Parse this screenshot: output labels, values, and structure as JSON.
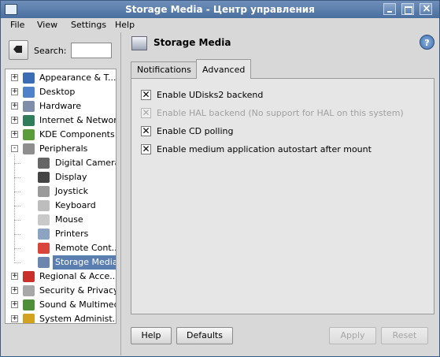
{
  "window": {
    "title": "Storage Media - Центр управления"
  },
  "menubar": {
    "items": [
      "File",
      "View",
      "Settings",
      "Help"
    ]
  },
  "sidebar": {
    "search_label": "Search:",
    "search_value": "",
    "tree": [
      {
        "label": "Appearance & T...",
        "icon": "appearance-icon",
        "expander": "+",
        "color": "#3b6db3"
      },
      {
        "label": "Desktop",
        "icon": "desktop-icon",
        "expander": "+",
        "color": "#4f82c6"
      },
      {
        "label": "Hardware",
        "icon": "hardware-icon",
        "expander": "+",
        "color": "#7f8ea8"
      },
      {
        "label": "Internet & Network",
        "icon": "globe-icon",
        "expander": "+",
        "color": "#2f7d5a"
      },
      {
        "label": "KDE Components",
        "icon": "components-icon",
        "expander": "+",
        "color": "#5c9d3b"
      },
      {
        "label": "Peripherals",
        "icon": "peripherals-icon",
        "expander": "-",
        "color": "#8e8e8e"
      },
      {
        "label": "Digital Camera",
        "icon": "camera-icon",
        "color": "#666666"
      },
      {
        "label": "Display",
        "icon": "display-icon",
        "color": "#444444"
      },
      {
        "label": "Joystick",
        "icon": "joystick-icon",
        "color": "#9a9a9a"
      },
      {
        "label": "Keyboard",
        "icon": "keyboard-icon",
        "color": "#bdbdbd"
      },
      {
        "label": "Mouse",
        "icon": "mouse-icon",
        "color": "#c9c9c9"
      },
      {
        "label": "Printers",
        "icon": "printer-icon",
        "color": "#8ca3c2"
      },
      {
        "label": "Remote Cont...",
        "icon": "remote-control-icon",
        "color": "#d9453b"
      },
      {
        "label": "Storage Media",
        "icon": "storage-media-icon",
        "color": "#6d86ad",
        "selected": true
      },
      {
        "label": "Regional & Acce...",
        "icon": "flag-icon",
        "expander": "+",
        "color": "#c9302c"
      },
      {
        "label": "Security & Privacy",
        "icon": "key-icon",
        "expander": "+",
        "color": "#a8a8a8"
      },
      {
        "label": "Sound & Multimedia",
        "icon": "sound-icon",
        "expander": "+",
        "color": "#4f8f3a"
      },
      {
        "label": "System Administ...",
        "icon": "system-admin-icon",
        "expander": "+",
        "color": "#d3a21f"
      }
    ]
  },
  "content": {
    "title": "Storage Media",
    "tabs": [
      {
        "label": "Notifications",
        "active": false
      },
      {
        "label": "Advanced",
        "active": true
      }
    ],
    "options": [
      {
        "label": "Enable UDisks2 backend",
        "checked": true,
        "enabled": true
      },
      {
        "label": "Enable HAL backend (No support for HAL on this system)",
        "checked": true,
        "enabled": false
      },
      {
        "label": "Enable CD polling",
        "checked": true,
        "enabled": true
      },
      {
        "label": "Enable medium application autostart after mount",
        "checked": true,
        "enabled": true
      }
    ]
  },
  "buttons": {
    "help": "Help",
    "defaults": "Defaults",
    "apply": "Apply",
    "reset": "Reset"
  }
}
